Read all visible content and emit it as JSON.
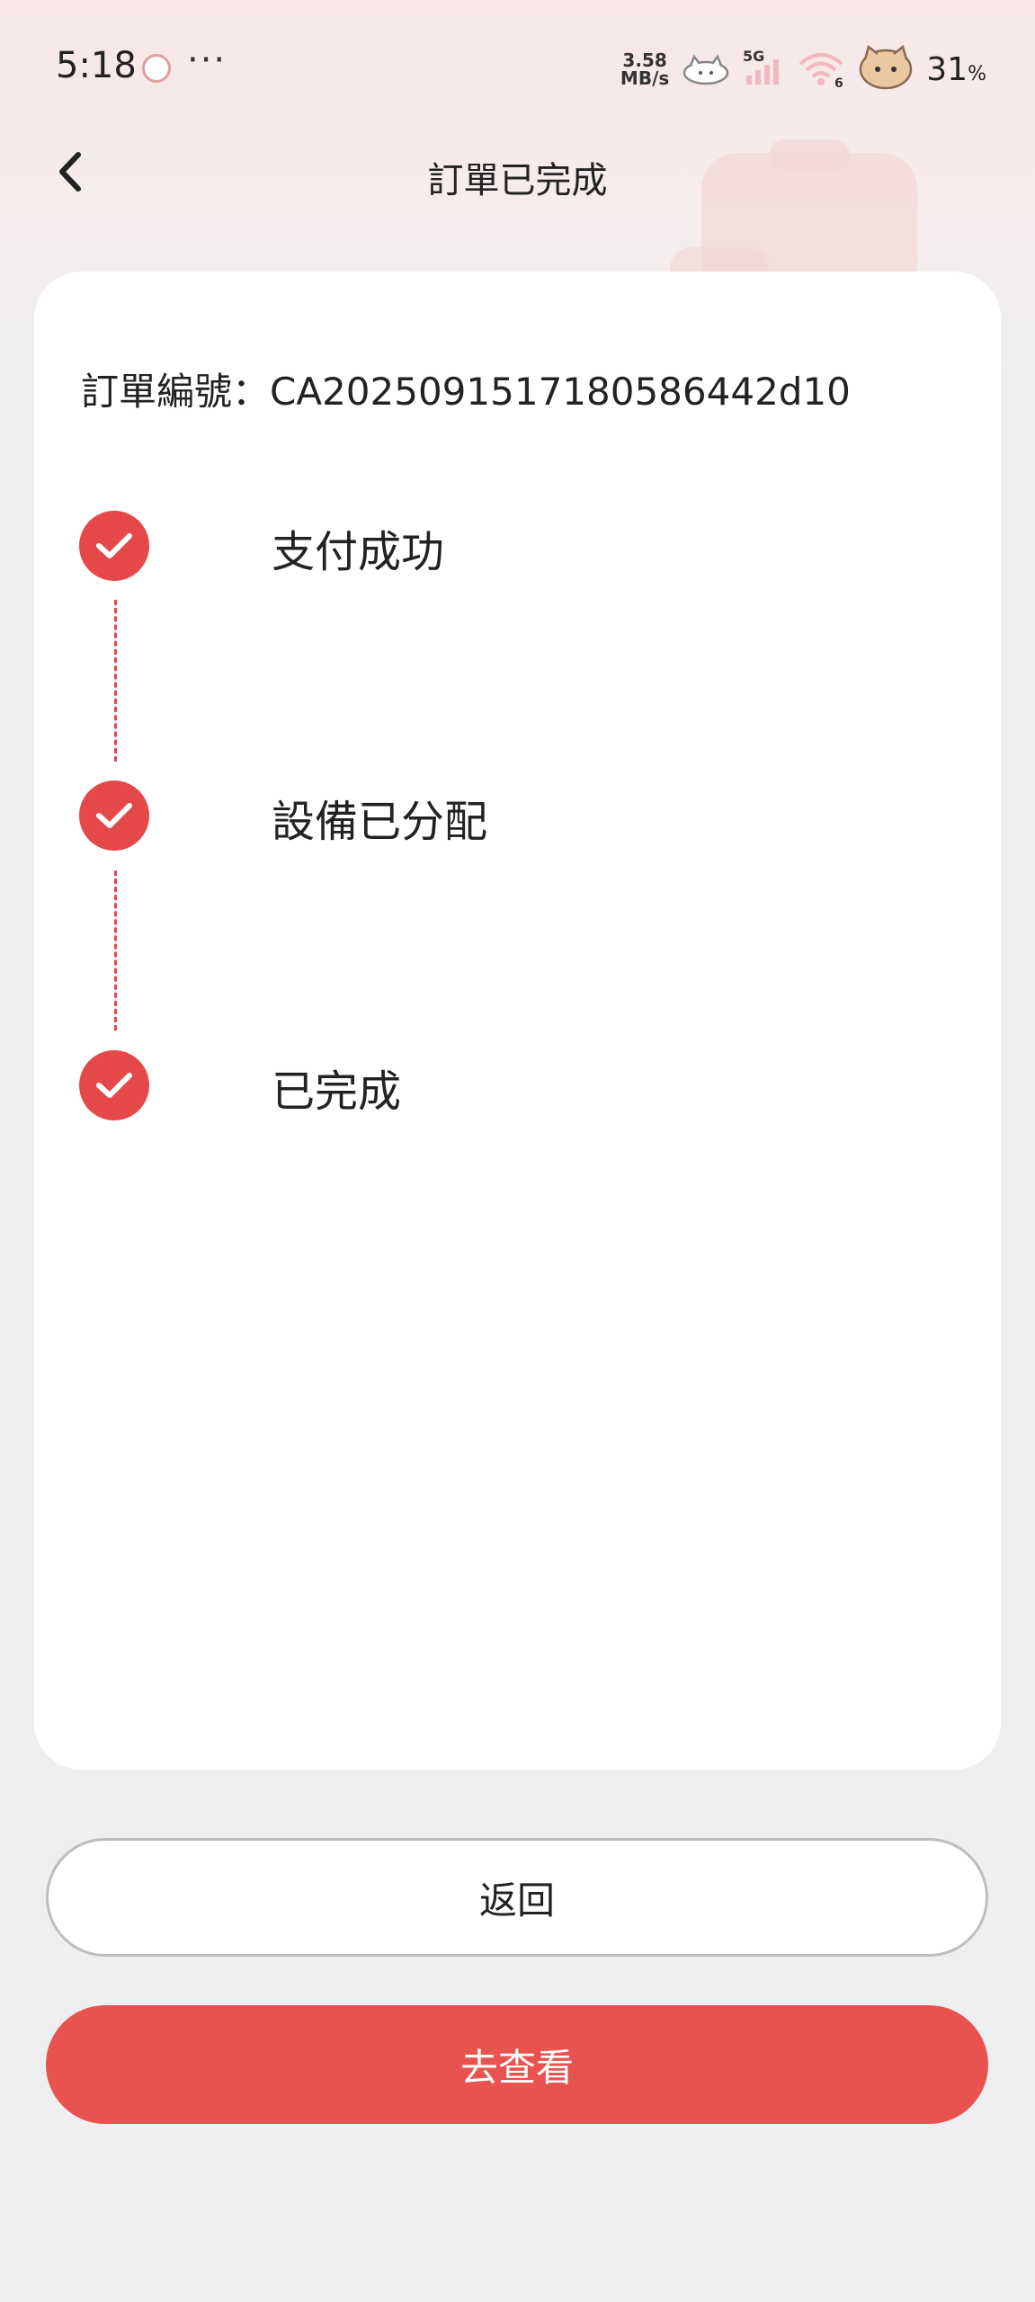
{
  "status_bar": {
    "time": "5:18",
    "more": "···",
    "net_speed_value": "3.58",
    "net_speed_unit": "MB/s",
    "network": "5G",
    "wifi_badge": "6",
    "battery_value": "31",
    "battery_unit": "%"
  },
  "header": {
    "title": "訂單已完成",
    "back_icon": "chevron-left-icon"
  },
  "order": {
    "number_label": "訂單編號：",
    "number_value": "CA2025091517180586442d10"
  },
  "steps": [
    {
      "label": "支付成功",
      "icon": "check-icon",
      "done": true
    },
    {
      "label": "設備已分配",
      "icon": "check-icon",
      "done": true
    },
    {
      "label": "已完成",
      "icon": "check-icon",
      "done": true
    }
  ],
  "actions": {
    "back_label": "返回",
    "view_label": "去查看"
  },
  "colors": {
    "accent": "#e54848",
    "button_primary": "#e8534f",
    "background": "#efeff1"
  }
}
